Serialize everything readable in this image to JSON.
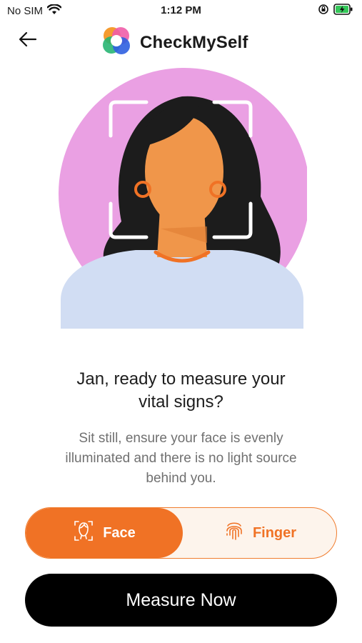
{
  "status_bar": {
    "carrier": "No SIM",
    "time": "1:12 PM",
    "icons": [
      "wifi-icon",
      "orientation-lock-icon",
      "battery-charging-icon"
    ]
  },
  "header": {
    "back_icon": "arrow-left-icon",
    "logo_icon": "checkmyself-logo-icon",
    "app_name": "CheckMySelf"
  },
  "hero": {
    "illustration": "woman-portrait-with-face-frame",
    "colors": {
      "circle": "#eaa0e3",
      "hair": "#1c1c1c",
      "skin": "#f0964a",
      "shirt": "#d1ddf3",
      "frame": "#ffffff"
    }
  },
  "prompt": {
    "title_line1": "Jan, ready to measure your",
    "title_line2": "vital signs?",
    "subtitle_line1": "Sit still, ensure your face is evenly",
    "subtitle_line2": "illuminated and there is no light source",
    "subtitle_line3": "behind you."
  },
  "mode_toggle": {
    "selected": "Face",
    "options": [
      {
        "label": "Face",
        "icon": "face-scan-icon"
      },
      {
        "label": "Finger",
        "icon": "fingerprint-icon"
      }
    ],
    "accent": "#f07225"
  },
  "measure_button": {
    "label": "Measure Now"
  }
}
